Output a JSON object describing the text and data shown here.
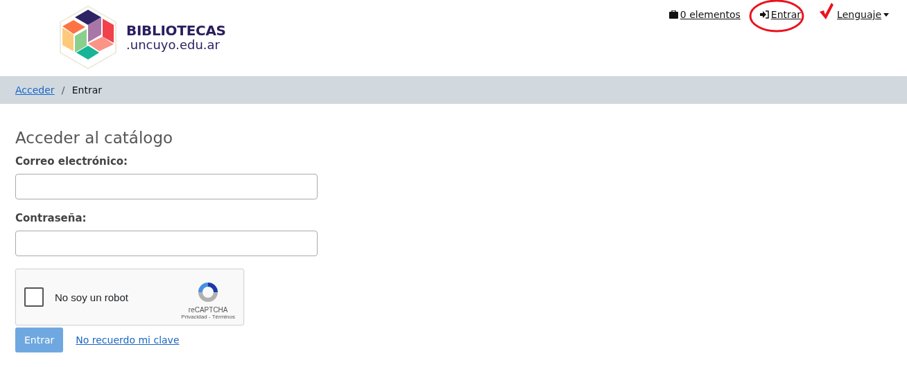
{
  "logo": {
    "title": "BIBLIOTECAS",
    "subtitle": ".uncuyo.edu.ar"
  },
  "nav": [
    {
      "kind": "cart",
      "label": "0 elementos"
    },
    {
      "kind": "login",
      "label": "Entrar"
    },
    {
      "kind": "menu",
      "label": "Lenguaje"
    }
  ],
  "annotations": {
    "login_circled": true,
    "language_checkmark": true
  },
  "breadcrumb": [
    {
      "label": "Acceder",
      "link": true
    },
    {
      "label": "Entrar",
      "link": false
    }
  ],
  "breadcrumb_separator": "/",
  "heading": "Acceder al catálogo",
  "fields": [
    {
      "label": "Correo electrónico:"
    },
    {
      "label": "Contraseña:"
    }
  ],
  "captcha": {
    "label": "No soy un robot",
    "checked": false,
    "brand": "reCAPTCHA",
    "links": "Privacidad - Términos"
  },
  "submit": {
    "label": "Entrar",
    "disabled": true
  },
  "forgot": "No recuerdo mi clave"
}
